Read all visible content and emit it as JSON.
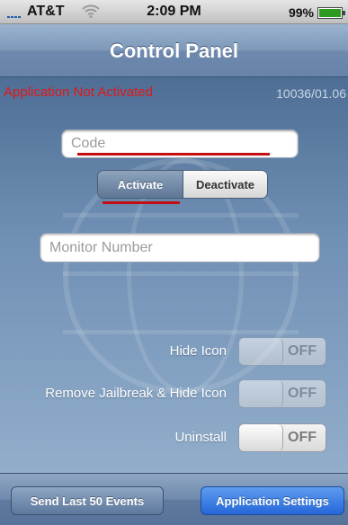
{
  "status_bar": {
    "carrier": "AT&T",
    "time": "2:09 PM",
    "battery": "99%",
    "battery_level": 0.99
  },
  "nav": {
    "title": "Control Panel"
  },
  "main": {
    "activation_status": "Application Not Activated",
    "version": "10036/01.06",
    "code_placeholder": "Code",
    "segment": {
      "activate": "Activate",
      "deactivate": "Deactivate",
      "selected": "Activate"
    },
    "monitor_placeholder": "Monitor Number",
    "settings": [
      {
        "label": "Hide Icon",
        "state": "OFF",
        "enabled": false
      },
      {
        "label": "Remove Jailbreak & Hide Icon",
        "state": "OFF",
        "enabled": false
      },
      {
        "label": "Uninstall",
        "state": "OFF",
        "enabled": true
      }
    ]
  },
  "toolbar": {
    "left_button": "Send Last 50 Events",
    "right_button": "Application Settings"
  },
  "colors": {
    "error_red": "#e01818",
    "accent_blue": "#2567d9"
  }
}
